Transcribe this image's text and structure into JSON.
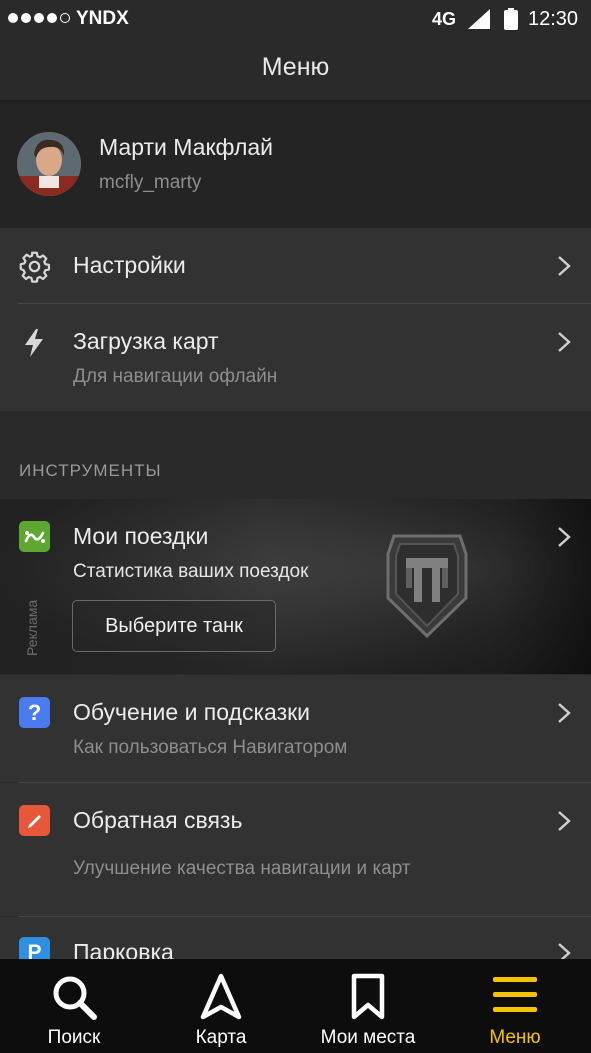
{
  "status_bar": {
    "carrier": "YNDX",
    "network": "4G",
    "time": "12:30"
  },
  "header": {
    "title": "Меню"
  },
  "profile": {
    "name": "Марти Макфлай",
    "login": "mcfly_marty"
  },
  "menu": {
    "settings": {
      "title": "Настройки"
    },
    "map_download": {
      "title": "Загрузка карт",
      "subtitle": "Для навигации офлайн"
    }
  },
  "tools": {
    "section_title": "ИНСТРУМЕНТЫ",
    "trips": {
      "title": "Мои поездки",
      "subtitle": "Статистика ваших поездок",
      "ad_label": "Реклама",
      "ad_button": "Выберите танк"
    },
    "tutorial": {
      "title": "Обучение и подсказки",
      "subtitle": "Как пользоваться Навигатором"
    },
    "feedback": {
      "title": "Обратная связь",
      "subtitle": "Улучшение качества навигации и карт"
    },
    "parking": {
      "title": "Парковка"
    }
  },
  "tab_bar": {
    "items": [
      {
        "label": "Поиск",
        "icon": "search-icon"
      },
      {
        "label": "Карта",
        "icon": "navigation-arrow-icon"
      },
      {
        "label": "Мои места",
        "icon": "bookmark-icon"
      },
      {
        "label": "Меню",
        "icon": "menu-icon",
        "active": true
      }
    ],
    "active_color": "#f5c400"
  },
  "colors": {
    "trips_icon": "#5ea832",
    "tutorial_icon": "#4a7cf0",
    "feedback_icon": "#e5593a",
    "parking_icon": "#2f8fe0"
  }
}
